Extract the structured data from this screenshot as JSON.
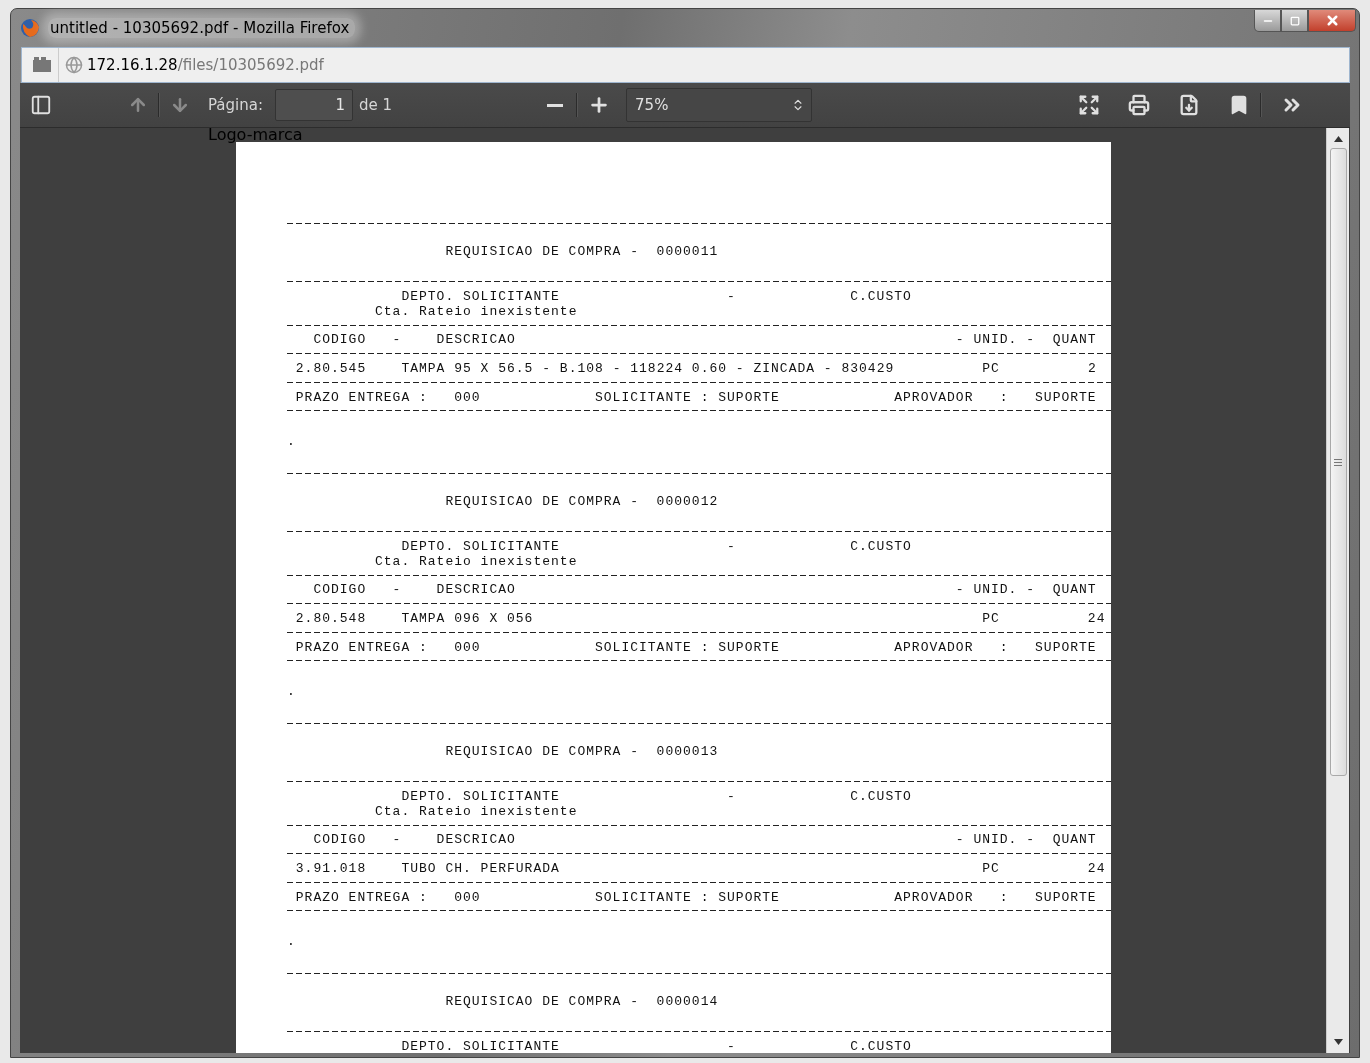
{
  "window": {
    "title": "untitled - 10305692.pdf - Mozilla Firefox"
  },
  "address_bar": {
    "host": "172.16.1.28",
    "path": "/files/10305692.pdf"
  },
  "toolbar": {
    "nav": [
      {
        "kind": "previous",
        "disabled": true
      },
      {
        "kind": "next",
        "disabled": true
      }
    ],
    "page_label": "Página:",
    "page_value": "1",
    "page_total": "de 1",
    "zoom": "75%"
  },
  "overlay_label": "Logo-marca",
  "requisitions": [
    {
      "title": "REQUISICAO DE COMPRA -  0000011",
      "dept": [
        "DEPTO. SOLICITANTE",
        "-",
        "C.CUSTO"
      ],
      "note": "Cta. Rateio inexistente",
      "columns": [
        "CODIGO",
        "-",
        "DESCRICAO",
        "- UNID. -",
        "QUANT"
      ],
      "item": [
        "2.80.545",
        "TAMPA 95 X 56.5 - B.108 - 118224 0.60 - ZINCADA - 830429",
        "PC",
        "2"
      ],
      "footer": [
        "PRAZO ENTREGA :",
        "000",
        "SOLICITANTE : SUPORTE",
        "APROVADOR   :   SUPORTE"
      ],
      "mark": "."
    },
    {
      "title": "REQUISICAO DE COMPRA -  0000012",
      "dept": [
        "DEPTO. SOLICITANTE",
        "-",
        "C.CUSTO"
      ],
      "note": "Cta. Rateio inexistente",
      "columns": [
        "CODIGO",
        "-",
        "DESCRICAO",
        "- UNID. -",
        "QUANT"
      ],
      "item": [
        "2.80.548",
        "TAMPA 096 X 056",
        "PC",
        "24"
      ],
      "footer": [
        "PRAZO ENTREGA :",
        "000",
        "SOLICITANTE : SUPORTE",
        "APROVADOR   :   SUPORTE"
      ],
      "mark": "."
    },
    {
      "title": "REQUISICAO DE COMPRA -  0000013",
      "dept": [
        "DEPTO. SOLICITANTE",
        "-",
        "C.CUSTO"
      ],
      "note": "Cta. Rateio inexistente",
      "columns": [
        "CODIGO",
        "-",
        "DESCRICAO",
        "- UNID. -",
        "QUANT"
      ],
      "item": [
        "3.91.018",
        "TUBO CH. PERFURADA",
        "PC",
        "24"
      ],
      "footer": [
        "PRAZO ENTREGA :",
        "000",
        "SOLICITANTE : SUPORTE",
        "APROVADOR   :   SUPORTE"
      ],
      "mark": "."
    },
    {
      "title": "REQUISICAO DE COMPRA -  0000014",
      "dept": [
        "DEPTO. SOLICITANTE",
        "-",
        "C.CUSTO"
      ]
    }
  ]
}
